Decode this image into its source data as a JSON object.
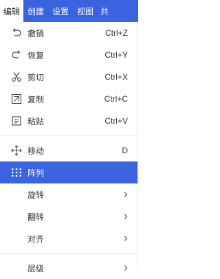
{
  "menubar": {
    "tabs": [
      {
        "label": "编辑",
        "active": true
      },
      {
        "label": "创建",
        "active": false
      },
      {
        "label": "设置",
        "active": false
      },
      {
        "label": "视图",
        "active": false
      },
      {
        "label": "共",
        "active": false
      }
    ]
  },
  "menu": {
    "undo": {
      "label": "撤销",
      "shortcut": "Ctrl+Z",
      "icon": "undo-icon"
    },
    "redo": {
      "label": "恢复",
      "shortcut": "Ctrl+Y",
      "icon": "redo-icon"
    },
    "cut": {
      "label": "剪切",
      "shortcut": "Ctrl+X",
      "icon": "scissors-icon"
    },
    "copy": {
      "label": "复制",
      "shortcut": "Ctrl+C",
      "icon": "copy-icon"
    },
    "paste": {
      "label": "粘贴",
      "shortcut": "Ctrl+V",
      "icon": "paste-icon"
    },
    "move": {
      "label": "移动",
      "shortcut": "D",
      "icon": "move-icon"
    },
    "array": {
      "label": "阵列",
      "icon": "grid-dots-icon",
      "selected": true
    },
    "rotate": {
      "label": "旋转"
    },
    "flip": {
      "label": "翻转"
    },
    "align": {
      "label": "对齐"
    },
    "layer": {
      "label": "层级"
    }
  },
  "colors": {
    "accent": "#3b63e0",
    "text": "#333333",
    "separator": "#e8e8e8"
  }
}
